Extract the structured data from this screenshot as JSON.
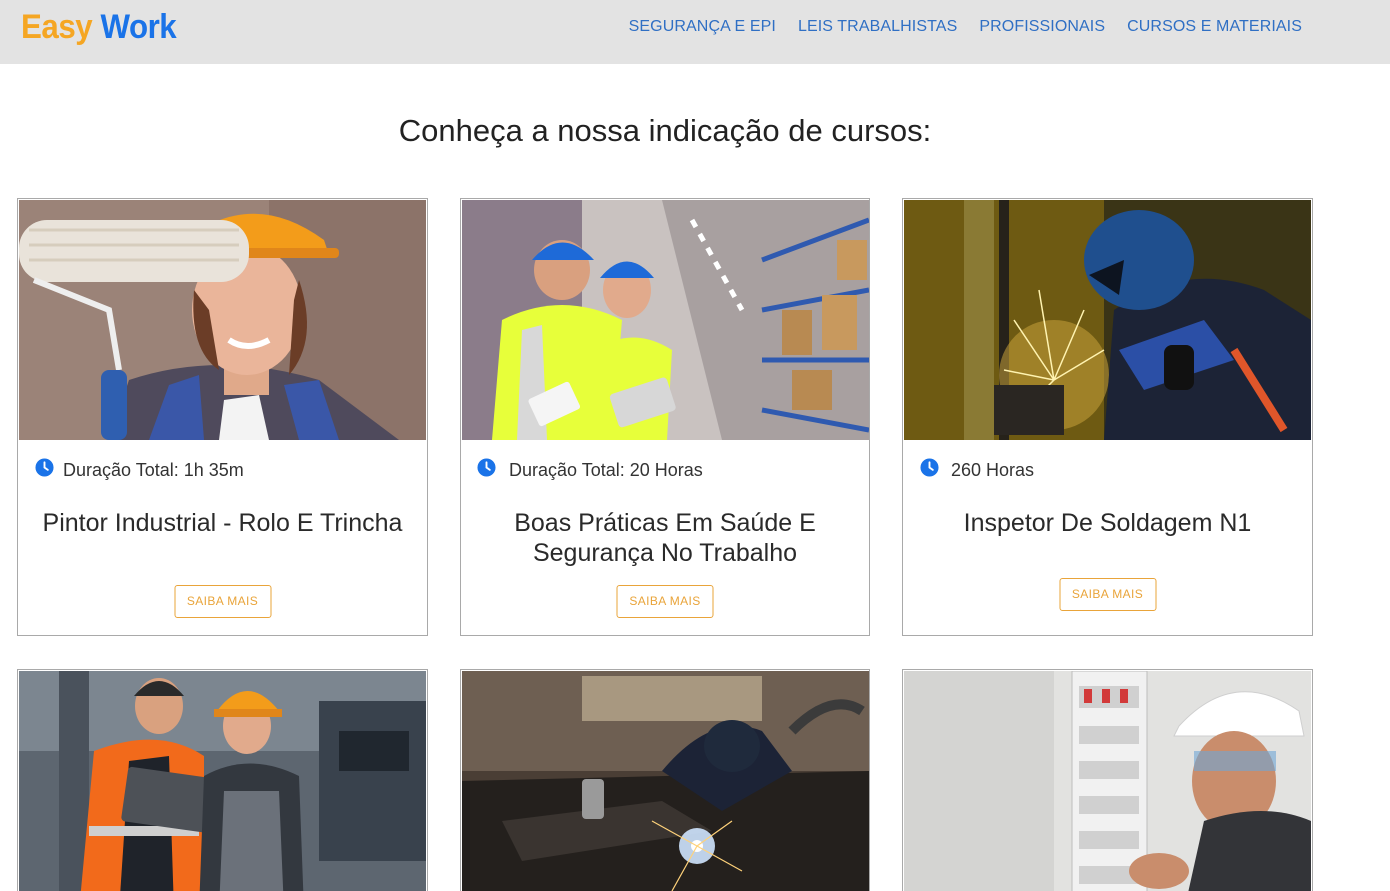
{
  "brand": {
    "part1": "Easy",
    "part2": "Work"
  },
  "nav": [
    {
      "label": "SEGURANÇA E EPI"
    },
    {
      "label": "LEIS TRABALHISTAS"
    },
    {
      "label": "PROFISSIONAIS"
    },
    {
      "label": "CURSOS E MATERIAIS"
    }
  ],
  "section_title": "Conheça a nossa indicação de cursos:",
  "cards": [
    {
      "meta": "Duração Total: 1h 35m",
      "title": "Pintor Industrial - Rolo E Trincha",
      "button": "SAIBA MAIS"
    },
    {
      "meta": "Duração Total: 20 Horas",
      "title": "Boas Práticas Em Saúde E Segurança No Trabalho",
      "button": "SAIBA MAIS"
    },
    {
      "meta": "260 Horas",
      "title": "Inspetor De Soldagem N1",
      "button": "SAIBA MAIS"
    },
    {
      "meta": "",
      "title": "",
      "button": ""
    },
    {
      "meta": "",
      "title": "",
      "button": ""
    },
    {
      "meta": "",
      "title": "",
      "button": ""
    }
  ],
  "colors": {
    "brand_orange": "#f5a623",
    "brand_blue": "#1a73e8",
    "nav_link": "#2f6fc4",
    "button_accent": "#e9a43a",
    "clock_icon": "#1a73e8"
  },
  "icons": {
    "duration": "clock-icon"
  }
}
